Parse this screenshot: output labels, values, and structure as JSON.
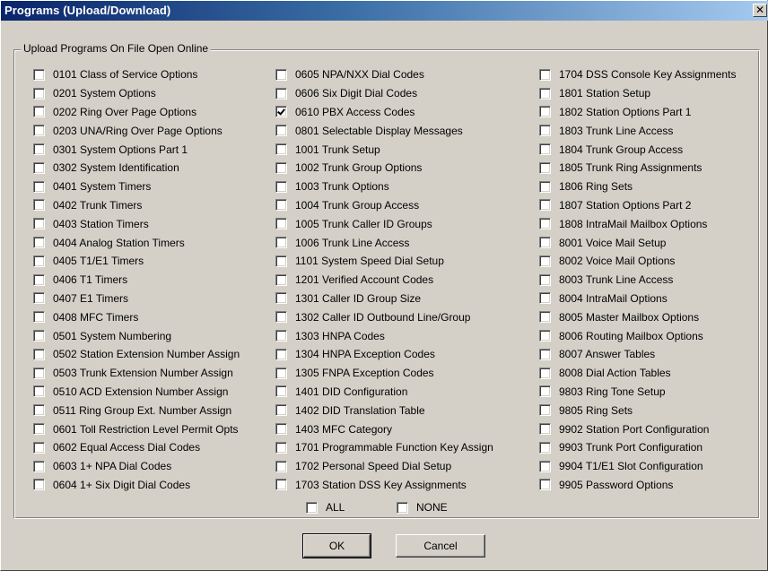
{
  "window": {
    "title": "Programs (Upload/Download)",
    "close_glyph": "✕"
  },
  "group": {
    "label": "Upload Programs On File Open Online"
  },
  "columns": [
    [
      {
        "label": "0101 Class of Service Options",
        "checked": false
      },
      {
        "label": "0201 System Options",
        "checked": false
      },
      {
        "label": "0202 Ring Over Page Options",
        "checked": false
      },
      {
        "label": "0203 UNA/Ring Over Page Options",
        "checked": false
      },
      {
        "label": "0301 System Options Part 1",
        "checked": false
      },
      {
        "label": "0302 System Identification",
        "checked": false
      },
      {
        "label": "0401 System Timers",
        "checked": false
      },
      {
        "label": "0402 Trunk Timers",
        "checked": false
      },
      {
        "label": "0403 Station Timers",
        "checked": false
      },
      {
        "label": "0404 Analog Station Timers",
        "checked": false
      },
      {
        "label": "0405 T1/E1 Timers",
        "checked": false
      },
      {
        "label": "0406 T1 Timers",
        "checked": false
      },
      {
        "label": "0407 E1 Timers",
        "checked": false
      },
      {
        "label": "0408 MFC Timers",
        "checked": false
      },
      {
        "label": "0501 System Numbering",
        "checked": false
      },
      {
        "label": "0502 Station Extension Number Assign",
        "checked": false
      },
      {
        "label": "0503 Trunk Extension Number Assign",
        "checked": false
      },
      {
        "label": "0510 ACD Extension Number Assign",
        "checked": false
      },
      {
        "label": "0511 Ring Group Ext. Number Assign",
        "checked": false
      },
      {
        "label": "0601 Toll Restriction Level Permit Opts",
        "checked": false
      },
      {
        "label": "0602 Equal Access Dial Codes",
        "checked": false
      },
      {
        "label": "0603 1+ NPA Dial Codes",
        "checked": false
      },
      {
        "label": "0604 1+ Six Digit Dial Codes",
        "checked": false
      }
    ],
    [
      {
        "label": "0605 NPA/NXX Dial Codes",
        "checked": false
      },
      {
        "label": "0606 Six Digit Dial Codes",
        "checked": false
      },
      {
        "label": "0610 PBX Access Codes",
        "checked": true
      },
      {
        "label": "0801 Selectable Display Messages",
        "checked": false
      },
      {
        "label": "1001 Trunk Setup",
        "checked": false
      },
      {
        "label": "1002 Trunk Group Options",
        "checked": false
      },
      {
        "label": "1003 Trunk Options",
        "checked": false
      },
      {
        "label": "1004 Trunk Group Access",
        "checked": false
      },
      {
        "label": "1005 Trunk Caller ID Groups",
        "checked": false
      },
      {
        "label": "1006 Trunk Line Access",
        "checked": false
      },
      {
        "label": "1101 System Speed Dial Setup",
        "checked": false
      },
      {
        "label": "1201 Verified Account Codes",
        "checked": false
      },
      {
        "label": "1301 Caller ID Group Size",
        "checked": false
      },
      {
        "label": "1302 Caller ID Outbound Line/Group",
        "checked": false
      },
      {
        "label": "1303 HNPA Codes",
        "checked": false
      },
      {
        "label": "1304 HNPA Exception Codes",
        "checked": false
      },
      {
        "label": "1305 FNPA Exception Codes",
        "checked": false
      },
      {
        "label": "1401 DID Configuration",
        "checked": false
      },
      {
        "label": "1402 DID Translation Table",
        "checked": false
      },
      {
        "label": "1403 MFC Category",
        "checked": false
      },
      {
        "label": "1701 Programmable Function Key Assign",
        "checked": false
      },
      {
        "label": "1702 Personal Speed Dial Setup",
        "checked": false
      },
      {
        "label": "1703 Station DSS Key Assignments",
        "checked": false
      }
    ],
    [
      {
        "label": "1704 DSS Console Key Assignments",
        "checked": false
      },
      {
        "label": "1801 Station Setup",
        "checked": false
      },
      {
        "label": "1802 Station Options Part 1",
        "checked": false
      },
      {
        "label": "1803 Trunk Line Access",
        "checked": false
      },
      {
        "label": "1804 Trunk Group Access",
        "checked": false
      },
      {
        "label": "1805 Trunk Ring Assignments",
        "checked": false
      },
      {
        "label": "1806 Ring Sets",
        "checked": false
      },
      {
        "label": "1807 Station Options Part 2",
        "checked": false
      },
      {
        "label": "1808 IntraMail Mailbox Options",
        "checked": false
      },
      {
        "label": "8001 Voice Mail Setup",
        "checked": false
      },
      {
        "label": "8002 Voice Mail Options",
        "checked": false
      },
      {
        "label": "8003 Trunk Line Access",
        "checked": false
      },
      {
        "label": "8004 IntraMail Options",
        "checked": false
      },
      {
        "label": "8005 Master Mailbox Options",
        "checked": false
      },
      {
        "label": "8006 Routing Mailbox Options",
        "checked": false
      },
      {
        "label": "8007 Answer Tables",
        "checked": false
      },
      {
        "label": "8008 Dial Action Tables",
        "checked": false
      },
      {
        "label": "9803 Ring Tone Setup",
        "checked": false
      },
      {
        "label": "9805 Ring Sets",
        "checked": false
      },
      {
        "label": "9902 Station Port Configuration",
        "checked": false
      },
      {
        "label": "9903 Trunk Port Configuration",
        "checked": false
      },
      {
        "label": "9904 T1/E1 Slot Configuration",
        "checked": false
      },
      {
        "label": "9905 Password Options",
        "checked": false
      }
    ]
  ],
  "select_all": {
    "label": "ALL",
    "checked": false
  },
  "select_none": {
    "label": "NONE",
    "checked": false
  },
  "buttons": {
    "ok": "OK",
    "cancel": "Cancel"
  }
}
